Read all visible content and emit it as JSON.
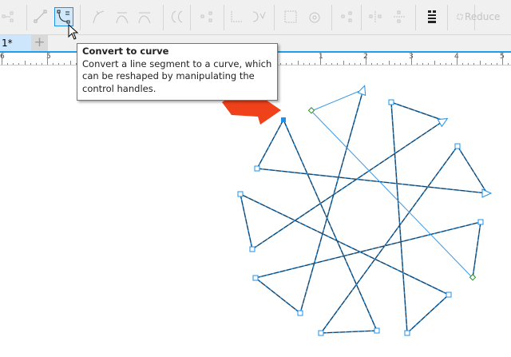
{
  "toolbar": {
    "icons": [
      "node-align-icon",
      "line-segment-icon",
      "convert-to-curve-icon",
      "cusp-node-icon",
      "smooth-node-icon",
      "symmetric-node-icon",
      "reverse-direction-icon",
      "break-curve-icon",
      "join-nodes-icon",
      "extend-curve-icon",
      "extract-subpath-icon",
      "stretch-nodes-icon",
      "rotate-nodes-icon",
      "align-nodes-icon",
      "mirror-horizontal-icon",
      "mirror-vertical-icon",
      "select-all-nodes-icon",
      "elastic-mode-icon"
    ],
    "reduce_label": "Reduce",
    "active_tool": "convert-to-curve"
  },
  "tabs": {
    "document": "1*",
    "add": "+"
  },
  "ruler": {
    "labels": [
      "6",
      "5",
      "1",
      "2",
      "3",
      "4",
      "5"
    ]
  },
  "tooltip": {
    "title": "Convert to curve",
    "body": "Convert a line segment to a curve, which can be reshaped by manipulating the control handles."
  },
  "colors": {
    "accent": "#1e90e8",
    "arrow": "#f0421a",
    "selected_node": "#1e90e8",
    "start_node": "#2e8b2e"
  }
}
